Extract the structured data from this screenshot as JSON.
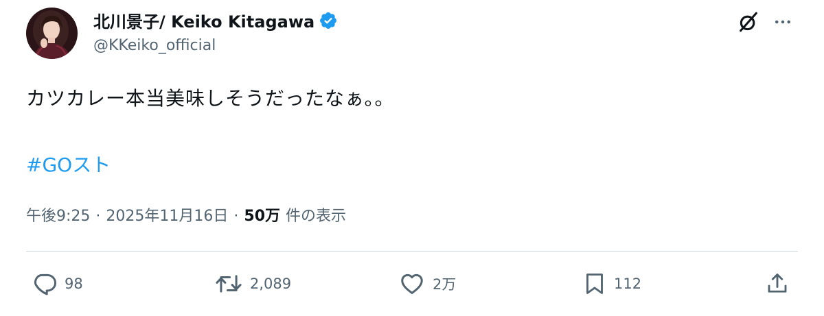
{
  "author": {
    "display_name": "北川景子/ Keiko Kitagawa",
    "handle": "@KKeiko_official",
    "avatar_icon": "avatar-photo",
    "verified_icon": "verified-badge-icon"
  },
  "header_actions": {
    "grok_icon": "grok-icon",
    "more_icon": "more-dots-icon"
  },
  "tweet": {
    "text": "カツカレー本当美味しそうだったなぁ。。",
    "hashtag": "#GOスト"
  },
  "meta": {
    "time": "午後9:25",
    "separator": "·",
    "date": "2025年11月16日",
    "views_count": "50万",
    "views_label": "件の表示"
  },
  "actions": {
    "reply": {
      "icon": "reply-icon",
      "count": "98"
    },
    "retweet": {
      "icon": "retweet-icon",
      "count": "2,089"
    },
    "like": {
      "icon": "heart-icon",
      "count": "2万"
    },
    "bookmark": {
      "icon": "bookmark-icon",
      "count": "112"
    },
    "share": {
      "icon": "share-icon"
    }
  },
  "colors": {
    "text": "#0f1419",
    "secondary": "#536471",
    "accent": "#1d9bf0",
    "divider": "#cfd9de"
  }
}
